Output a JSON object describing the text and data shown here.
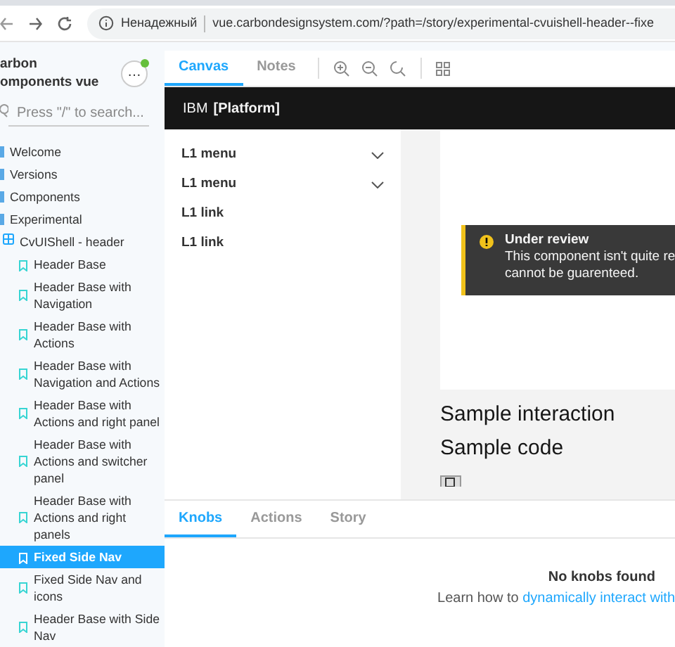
{
  "browser": {
    "security_label": "Ненадежный",
    "url": "vue.carbondesignsystem.com/?path=/story/experimental-cvuishell-header--fixe"
  },
  "sidebar": {
    "title_lines": [
      "arbon",
      "omponents vue"
    ],
    "menu_label": "…",
    "status_dot": true,
    "search": {
      "placeholder": "Press \"/\" to search..."
    },
    "tree": [
      {
        "label": "Welcome",
        "kind": "folder"
      },
      {
        "label": "Versions",
        "kind": "folder"
      },
      {
        "label": "Components",
        "kind": "folder"
      },
      {
        "label": "Experimental",
        "kind": "folder",
        "children": [
          {
            "label": "CvUIShell - header",
            "kind": "component",
            "children": [
              {
                "label": "Header Base",
                "kind": "story",
                "selected": false
              },
              {
                "label": "Header Base with Navigation",
                "kind": "story",
                "selected": false
              },
              {
                "label": "Header Base with Actions",
                "kind": "story",
                "selected": false
              },
              {
                "label": "Header Base with Navigation and Actions",
                "kind": "story",
                "selected": false
              },
              {
                "label": "Header Base with Actions and right panel",
                "kind": "story",
                "selected": false
              },
              {
                "label": "Header Base with Actions and switcher panel",
                "kind": "story",
                "selected": false
              },
              {
                "label": "Header Base with Actions and right panels",
                "kind": "story",
                "selected": false
              },
              {
                "label": "Fixed Side Nav",
                "kind": "story",
                "selected": true
              },
              {
                "label": "Fixed Side Nav and icons",
                "kind": "story",
                "selected": false
              },
              {
                "label": "Header Base with Side Nav",
                "kind": "story",
                "selected": false
              }
            ]
          }
        ]
      }
    ]
  },
  "toolbar": {
    "tabs": [
      {
        "label": "Canvas",
        "selected": true
      },
      {
        "label": "Notes",
        "selected": false
      }
    ]
  },
  "preview": {
    "header": {
      "brand": "IBM",
      "product": "[Platform]"
    },
    "side_nav": [
      {
        "label": "L1 menu",
        "kind": "menu"
      },
      {
        "label": "L1 menu",
        "kind": "menu"
      },
      {
        "label": "L1 link",
        "kind": "link"
      },
      {
        "label": "L1 link",
        "kind": "link"
      }
    ],
    "notification": {
      "title": "Under review",
      "message": "This component isn't quite re cannot be guarenteed."
    },
    "headings": [
      "Sample interaction",
      "Sample code"
    ]
  },
  "addons": {
    "tabs": [
      {
        "label": "Knobs",
        "selected": true
      },
      {
        "label": "Actions",
        "selected": false
      },
      {
        "label": "Story",
        "selected": false
      }
    ],
    "empty_title": "No knobs found",
    "empty_text": "Learn how to ",
    "empty_link": "dynamically interact with"
  }
}
